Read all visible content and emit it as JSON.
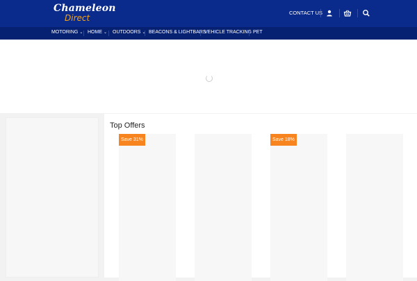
{
  "header": {
    "logo_line1": "Chameleon",
    "logo_line2": "Direct",
    "contact_label": "CONTACT US",
    "icons": [
      "user-icon",
      "basket-icon",
      "search-icon"
    ]
  },
  "nav": {
    "items": [
      {
        "label": "MOTORING",
        "dropdown": true
      },
      {
        "label": "HOME",
        "dropdown": true
      },
      {
        "label": "OUTDOORS",
        "dropdown": true
      },
      {
        "label": "BEACONS & LIGHTBARS",
        "dropdown": false
      },
      {
        "label": "VEHICLE TRACKING",
        "dropdown": false
      },
      {
        "label": "PET",
        "dropdown": false
      }
    ]
  },
  "main": {
    "section_title": "Top Offers",
    "cards": [
      {
        "badge": "Save 31%"
      },
      {
        "badge": ""
      },
      {
        "badge": "Save 18%"
      },
      {
        "badge": ""
      }
    ]
  },
  "colors": {
    "header_bg": "#0a2a8c",
    "nav_bg": "#062072",
    "logo_accent": "#f5a31a",
    "badge_bg": "#f7841e"
  }
}
